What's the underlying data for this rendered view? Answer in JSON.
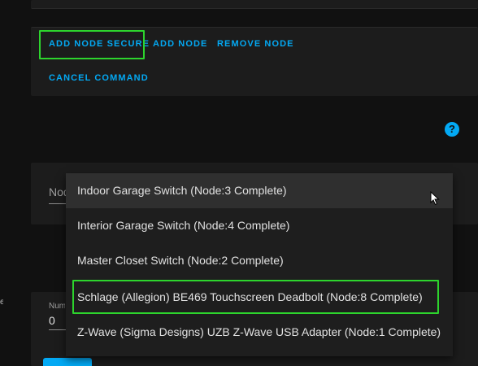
{
  "actions": {
    "add_node_secure": "ADD NODE SECURE",
    "add_node": "ADD NODE",
    "remove_node": "REMOVE NODE",
    "cancel_command": "CANCEL COMMAND"
  },
  "help_icon": "?",
  "node_select": {
    "label": "Node"
  },
  "config": {
    "label": "Number",
    "value": "0"
  },
  "side_text": "e",
  "dropdown": {
    "items": [
      {
        "label": "Indoor Garage Switch (Node:3 Complete)",
        "selected": true
      },
      {
        "label": "Interior Garage Switch (Node:4 Complete)",
        "selected": false
      },
      {
        "label": "Master Closet Switch (Node:2 Complete)",
        "selected": false
      },
      {
        "label": "Schlage (Allegion) BE469 Touchscreen Deadbolt (Node:8 Complete)",
        "selected": false
      },
      {
        "label": "Z-Wave (Sigma Designs) UZB Z-Wave USB Adapter (Node:1 Complete)",
        "selected": false
      }
    ]
  },
  "colors": {
    "accent": "#03a9f4",
    "highlight": "#2dd42d",
    "background": "#111111",
    "card": "#1c1c1c"
  }
}
